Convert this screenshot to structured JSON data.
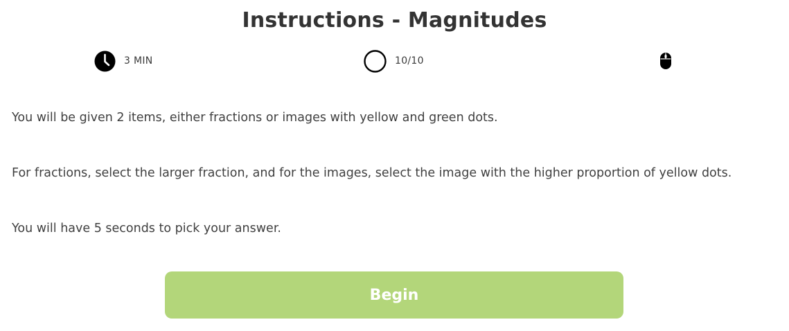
{
  "header": {
    "title": "Instructions - Magnitudes"
  },
  "info": {
    "time": {
      "icon": "clock-icon",
      "label": "3 MIN"
    },
    "progress": {
      "icon": "circle-icon",
      "label": "10/10"
    },
    "input": {
      "icon": "mouse-icon"
    }
  },
  "instructions": {
    "p1": "You will be given 2 items, either fractions or images with yellow and green dots.",
    "p2": "For fractions, select the larger fraction, and for the images, select the image with the higher proportion of yellow dots.",
    "p3": "You will have 5 seconds to pick your answer."
  },
  "actions": {
    "begin_label": "Begin"
  },
  "colors": {
    "button": "#b3d67a",
    "text": "#3a3a3a",
    "button_text": "#ffffff"
  }
}
